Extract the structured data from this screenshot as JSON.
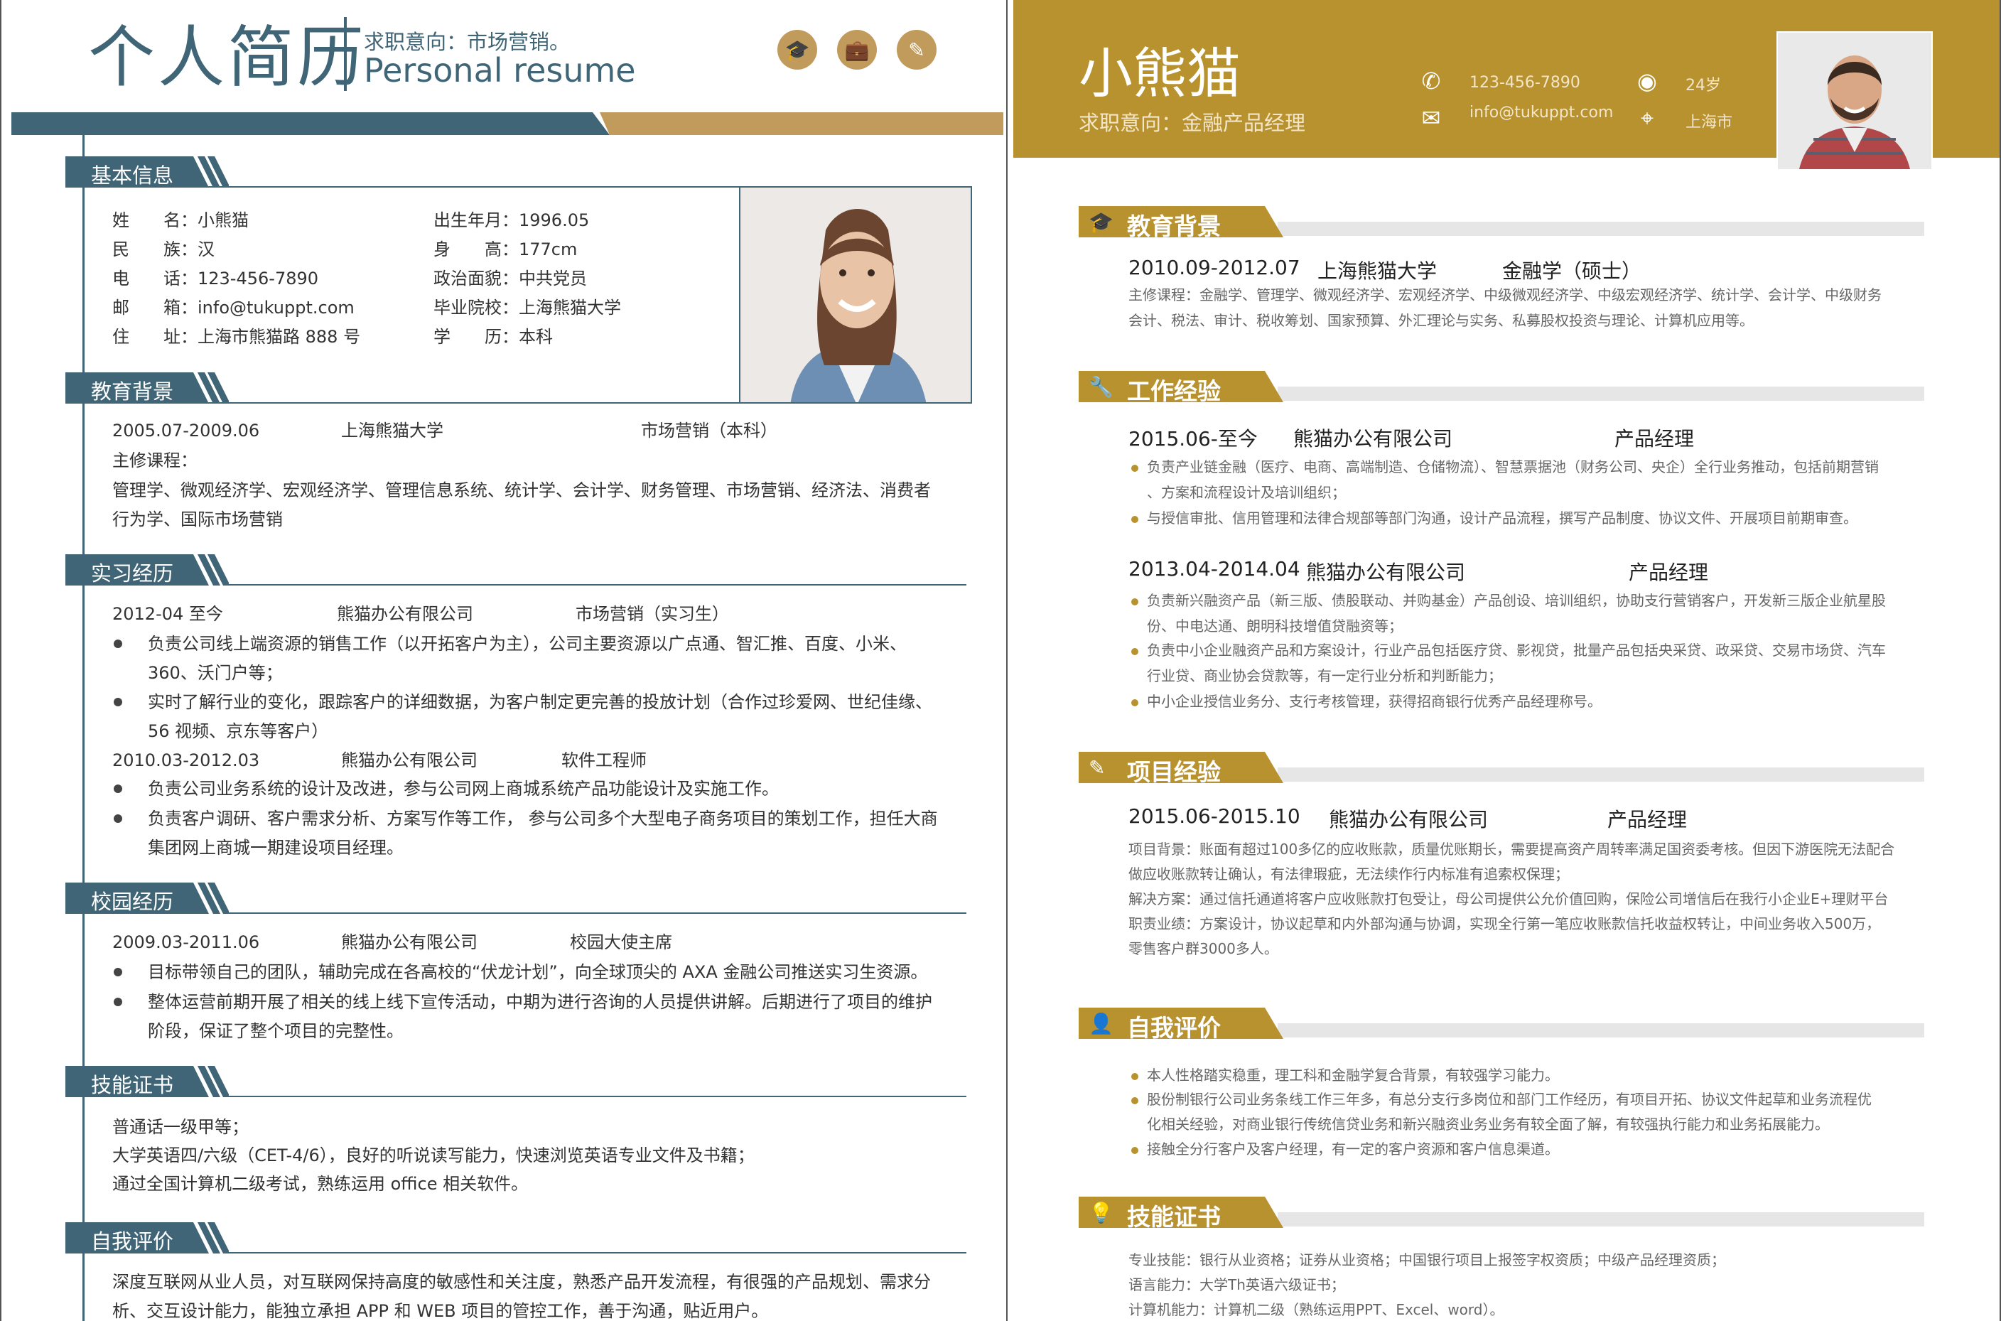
{
  "left": {
    "title": "个人简历",
    "intent": "求职意向：市场营销。",
    "subtitle": "Personal resume",
    "header_icons": [
      "graduation-cap-icon",
      "briefcase-icon",
      "pencil-icon"
    ],
    "colors": {
      "primary": "#3f6577",
      "accent": "#c19b5c"
    },
    "basic": {
      "heading": "基本信息",
      "rows_left": [
        {
          "label": "姓　　名：",
          "value": "小熊猫"
        },
        {
          "label": "民　　族：",
          "value": "汉"
        },
        {
          "label": "电　　话：",
          "value": "123-456-7890"
        },
        {
          "label": "邮　　箱：",
          "value": "info@tukuppt.com"
        },
        {
          "label": "住　　址：",
          "value": "上海市熊猫路 888 号"
        }
      ],
      "rows_right": [
        {
          "label": "出生年月：",
          "value": "1996.05"
        },
        {
          "label": "身　　高：",
          "value": "177cm"
        },
        {
          "label": "政治面貌：",
          "value": "中共党员"
        },
        {
          "label": "毕业院校：",
          "value": "上海熊猫大学"
        },
        {
          "label": "学　　历：",
          "value": "本科"
        }
      ]
    },
    "education": {
      "heading": "教育背景",
      "date": "2005.07-2009.06",
      "school": "上海熊猫大学",
      "major": "市场营销（本科）",
      "courses_label": "主修课程：",
      "courses": "管理学、微观经济学、宏观经济学、管理信息系统、统计学、会计学、财务管理、市场营销、经济法、消费者行为学、国际市场营销"
    },
    "internship": {
      "heading": "实习经历",
      "jobs": [
        {
          "date": "2012-04 至今",
          "company": "熊猫办公有限公司",
          "role": "市场营销（实习生）",
          "bullets": [
            "负责公司线上端资源的销售工作（以开拓客户为主），公司主要资源以广点通、智汇推、百度、小米、360、沃门户等；",
            "实时了解行业的变化，跟踪客户的详细数据，为客户制定更完善的投放计划（合作过珍爱网、世纪佳缘、56 视频、京东等客户）"
          ]
        },
        {
          "date": "2010.03-2012.03",
          "company": "熊猫办公有限公司",
          "role": "软件工程师",
          "bullets": [
            "负责公司业务系统的设计及改进，参与公司网上商城系统产品功能设计及实施工作。",
            "负责客户调研、客户需求分析、方案写作等工作， 参与公司多个大型电子商务项目的策划工作，担任大商集团网上商城一期建设项目经理。"
          ]
        }
      ]
    },
    "campus": {
      "heading": "校园经历",
      "date": "2009.03-2011.06",
      "company": "熊猫办公有限公司",
      "role": "校园大使主席",
      "bullets": [
        "目标带领自己的团队，辅助完成在各高校的“伏龙计划”，向全球顶尖的 AXA 金融公司推送实习生资源。",
        "整体运营前期开展了相关的线上线下宣传活动，中期为进行咨询的人员提供讲解。后期进行了项目的维护阶段，保证了整个项目的完整性。"
      ]
    },
    "skills": {
      "heading": "技能证书",
      "lines": [
        "普通话一级甲等；",
        "大学英语四/六级（CET-4/6），良好的听说读写能力，快速浏览英语专业文件及书籍；",
        "通过全国计算机二级考试，熟练运用 office 相关软件。"
      ]
    },
    "self": {
      "heading": "自我评价",
      "text": "深度互联网从业人员，对互联网保持高度的敏感性和关注度，熟悉产品开发流程，有很强的产品规划、需求分析、交互设计能力，能独立承担 APP 和 WEB 项目的管控工作，善于沟通，贴近用户。"
    }
  },
  "right": {
    "name": "小熊猫",
    "intent": "求职意向：金融产品经理",
    "phone": "123-456-7890",
    "email": "info@tukuppt.com",
    "age": "24岁",
    "city": "上海市",
    "colors": {
      "primary": "#b8922f",
      "bar": "#e6e6e6"
    },
    "education": {
      "heading": "教育背景",
      "date": "2010.09-2012.07",
      "school": "上海熊猫大学",
      "major": "金融学（硕士）",
      "lines": [
        "主修课程：金融学、管理学、微观经济学、宏观经济学、中级微观经济学、中级宏观经济学、统计学、会计学、中级财务",
        "会计、税法、审计、税收筹划、国家预算、外汇理论与实务、私募股权投资与理论、计算机应用等。"
      ]
    },
    "work": {
      "heading": "工作经验",
      "jobs": [
        {
          "date": "2015.06-至今",
          "company": "熊猫办公有限公司",
          "role": "产品经理",
          "bullets": [
            [
              "负责产业链金融（医疗、电商、高端制造、仓储物流）、智慧票据池（财务公司、央企）全行业务推动，包括前期营销",
              "、方案和流程设计及培训组织；"
            ],
            [
              "与授信审批、信用管理和法律合规部等部门沟通，设计产品流程，撰写产品制度、协议文件、开展项目前期审查。"
            ]
          ]
        },
        {
          "date": "2013.04-2014.04",
          "company": "熊猫办公有限公司",
          "role": "产品经理",
          "bullets": [
            [
              "负责新兴融资产品（新三版、债股联动、并购基金）产品创设、培训组织，协助支行营销客户，开发新三版企业航星股",
              "份、中电达通、朗明科技增值贷融资等；"
            ],
            [
              "负责中小企业融资产品和方案设计，行业产品包括医疗贷、影视贷，批量产品包括央采贷、政采贷、交易市场贷、汽车",
              "行业贷、商业协会贷款等，有一定行业分析和判断能力；"
            ],
            [
              "中小企业授信业务分、支行考核管理，获得招商银行优秀产品经理称号。"
            ]
          ]
        }
      ]
    },
    "project": {
      "heading": "项目经验",
      "date": "2015.06-2015.10",
      "company": "熊猫办公有限公司",
      "role": "产品经理",
      "lines": [
        "项目背景：账面有超过100多亿的应收账款，质量优账期长，需要提高资产周转率满足国资委考核。但因下游医院无法配合",
        "做应收账款转让确认，有法律瑕疵，无法续作行内标准有追索权保理；",
        "解决方案：通过信托通道将客户应收账款打包受让，母公司提供公允价值回购，保险公司增信后在我行小企业E+理财平台",
        "职责业绩：方案设计，协议起草和内外部沟通与协调，实现全行第一笔应收账款信托收益权转让，中间业务收入500万，",
        "零售客户群3000多人。"
      ]
    },
    "self": {
      "heading": "自我评价",
      "bullets": [
        [
          "本人性格踏实稳重，理工科和金融学复合背景，有较强学习能力。"
        ],
        [
          "股份制银行公司业务条线工作三年多，有总分支行多岗位和部门工作经历，有项目开拓、协议文件起草和业务流程优",
          "化相关经验，对商业银行传统信贷业务和新兴融资业务业务有较全面了解，有较强执行能力和业务拓展能力。"
        ],
        [
          "接触全分行客户及客户经理，有一定的客户资源和客户信息渠道。"
        ]
      ]
    },
    "skills": {
      "heading": "技能证书",
      "lines": [
        "专业技能：银行从业资格；证券从业资格；中国银行项目上报签字权资质；中级产品经理资质；",
        "语言能力：大学Th英语六级证书；",
        "计算机能力：计算机二级（熟练运用PPT、Excel、word）。"
      ]
    }
  }
}
